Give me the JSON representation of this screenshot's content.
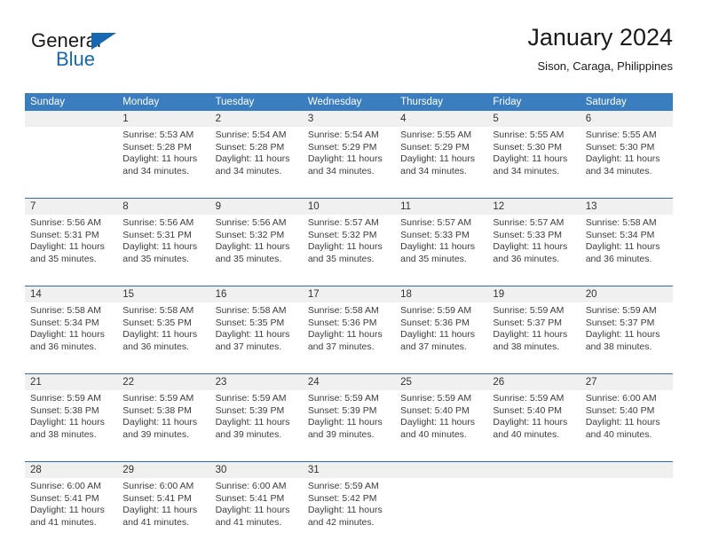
{
  "brand": {
    "name_dark": "General",
    "name_blue": "Blue",
    "logo_icon": "triangle-icon",
    "accent_color": "#1668b3"
  },
  "header": {
    "title": "January 2024",
    "subtitle": "Sison, Caraga, Philippines"
  },
  "colors": {
    "header_row_bg": "#3a7ebf",
    "week_divider": "#2f6fae",
    "number_band_bg": "#f0f0f0",
    "text": "#3c3c3c"
  },
  "weekdays": [
    "Sunday",
    "Monday",
    "Tuesday",
    "Wednesday",
    "Thursday",
    "Friday",
    "Saturday"
  ],
  "weeks": [
    {
      "days": [
        {
          "num": "",
          "sunrise": "",
          "sunset": "",
          "daylight": ""
        },
        {
          "num": "1",
          "sunrise": "Sunrise: 5:53 AM",
          "sunset": "Sunset: 5:28 PM",
          "daylight": "Daylight: 11 hours and 34 minutes."
        },
        {
          "num": "2",
          "sunrise": "Sunrise: 5:54 AM",
          "sunset": "Sunset: 5:28 PM",
          "daylight": "Daylight: 11 hours and 34 minutes."
        },
        {
          "num": "3",
          "sunrise": "Sunrise: 5:54 AM",
          "sunset": "Sunset: 5:29 PM",
          "daylight": "Daylight: 11 hours and 34 minutes."
        },
        {
          "num": "4",
          "sunrise": "Sunrise: 5:55 AM",
          "sunset": "Sunset: 5:29 PM",
          "daylight": "Daylight: 11 hours and 34 minutes."
        },
        {
          "num": "5",
          "sunrise": "Sunrise: 5:55 AM",
          "sunset": "Sunset: 5:30 PM",
          "daylight": "Daylight: 11 hours and 34 minutes."
        },
        {
          "num": "6",
          "sunrise": "Sunrise: 5:55 AM",
          "sunset": "Sunset: 5:30 PM",
          "daylight": "Daylight: 11 hours and 34 minutes."
        }
      ]
    },
    {
      "days": [
        {
          "num": "7",
          "sunrise": "Sunrise: 5:56 AM",
          "sunset": "Sunset: 5:31 PM",
          "daylight": "Daylight: 11 hours and 35 minutes."
        },
        {
          "num": "8",
          "sunrise": "Sunrise: 5:56 AM",
          "sunset": "Sunset: 5:31 PM",
          "daylight": "Daylight: 11 hours and 35 minutes."
        },
        {
          "num": "9",
          "sunrise": "Sunrise: 5:56 AM",
          "sunset": "Sunset: 5:32 PM",
          "daylight": "Daylight: 11 hours and 35 minutes."
        },
        {
          "num": "10",
          "sunrise": "Sunrise: 5:57 AM",
          "sunset": "Sunset: 5:32 PM",
          "daylight": "Daylight: 11 hours and 35 minutes."
        },
        {
          "num": "11",
          "sunrise": "Sunrise: 5:57 AM",
          "sunset": "Sunset: 5:33 PM",
          "daylight": "Daylight: 11 hours and 35 minutes."
        },
        {
          "num": "12",
          "sunrise": "Sunrise: 5:57 AM",
          "sunset": "Sunset: 5:33 PM",
          "daylight": "Daylight: 11 hours and 36 minutes."
        },
        {
          "num": "13",
          "sunrise": "Sunrise: 5:58 AM",
          "sunset": "Sunset: 5:34 PM",
          "daylight": "Daylight: 11 hours and 36 minutes."
        }
      ]
    },
    {
      "days": [
        {
          "num": "14",
          "sunrise": "Sunrise: 5:58 AM",
          "sunset": "Sunset: 5:34 PM",
          "daylight": "Daylight: 11 hours and 36 minutes."
        },
        {
          "num": "15",
          "sunrise": "Sunrise: 5:58 AM",
          "sunset": "Sunset: 5:35 PM",
          "daylight": "Daylight: 11 hours and 36 minutes."
        },
        {
          "num": "16",
          "sunrise": "Sunrise: 5:58 AM",
          "sunset": "Sunset: 5:35 PM",
          "daylight": "Daylight: 11 hours and 37 minutes."
        },
        {
          "num": "17",
          "sunrise": "Sunrise: 5:58 AM",
          "sunset": "Sunset: 5:36 PM",
          "daylight": "Daylight: 11 hours and 37 minutes."
        },
        {
          "num": "18",
          "sunrise": "Sunrise: 5:59 AM",
          "sunset": "Sunset: 5:36 PM",
          "daylight": "Daylight: 11 hours and 37 minutes."
        },
        {
          "num": "19",
          "sunrise": "Sunrise: 5:59 AM",
          "sunset": "Sunset: 5:37 PM",
          "daylight": "Daylight: 11 hours and 38 minutes."
        },
        {
          "num": "20",
          "sunrise": "Sunrise: 5:59 AM",
          "sunset": "Sunset: 5:37 PM",
          "daylight": "Daylight: 11 hours and 38 minutes."
        }
      ]
    },
    {
      "days": [
        {
          "num": "21",
          "sunrise": "Sunrise: 5:59 AM",
          "sunset": "Sunset: 5:38 PM",
          "daylight": "Daylight: 11 hours and 38 minutes."
        },
        {
          "num": "22",
          "sunrise": "Sunrise: 5:59 AM",
          "sunset": "Sunset: 5:38 PM",
          "daylight": "Daylight: 11 hours and 39 minutes."
        },
        {
          "num": "23",
          "sunrise": "Sunrise: 5:59 AM",
          "sunset": "Sunset: 5:39 PM",
          "daylight": "Daylight: 11 hours and 39 minutes."
        },
        {
          "num": "24",
          "sunrise": "Sunrise: 5:59 AM",
          "sunset": "Sunset: 5:39 PM",
          "daylight": "Daylight: 11 hours and 39 minutes."
        },
        {
          "num": "25",
          "sunrise": "Sunrise: 5:59 AM",
          "sunset": "Sunset: 5:40 PM",
          "daylight": "Daylight: 11 hours and 40 minutes."
        },
        {
          "num": "26",
          "sunrise": "Sunrise: 5:59 AM",
          "sunset": "Sunset: 5:40 PM",
          "daylight": "Daylight: 11 hours and 40 minutes."
        },
        {
          "num": "27",
          "sunrise": "Sunrise: 6:00 AM",
          "sunset": "Sunset: 5:40 PM",
          "daylight": "Daylight: 11 hours and 40 minutes."
        }
      ]
    },
    {
      "days": [
        {
          "num": "28",
          "sunrise": "Sunrise: 6:00 AM",
          "sunset": "Sunset: 5:41 PM",
          "daylight": "Daylight: 11 hours and 41 minutes."
        },
        {
          "num": "29",
          "sunrise": "Sunrise: 6:00 AM",
          "sunset": "Sunset: 5:41 PM",
          "daylight": "Daylight: 11 hours and 41 minutes."
        },
        {
          "num": "30",
          "sunrise": "Sunrise: 6:00 AM",
          "sunset": "Sunset: 5:41 PM",
          "daylight": "Daylight: 11 hours and 41 minutes."
        },
        {
          "num": "31",
          "sunrise": "Sunrise: 5:59 AM",
          "sunset": "Sunset: 5:42 PM",
          "daylight": "Daylight: 11 hours and 42 minutes."
        },
        {
          "num": "",
          "sunrise": "",
          "sunset": "",
          "daylight": ""
        },
        {
          "num": "",
          "sunrise": "",
          "sunset": "",
          "daylight": ""
        },
        {
          "num": "",
          "sunrise": "",
          "sunset": "",
          "daylight": ""
        }
      ]
    }
  ]
}
